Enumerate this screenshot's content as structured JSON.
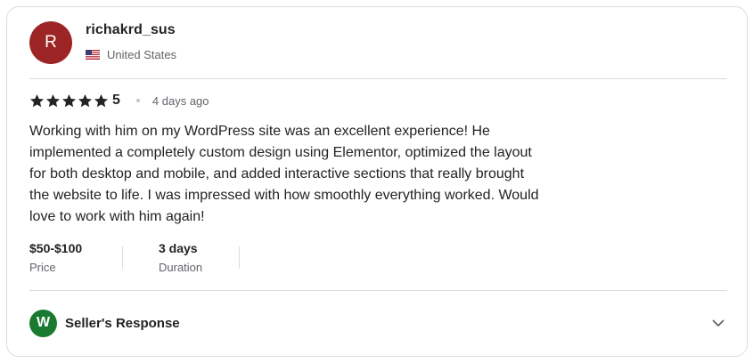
{
  "reviewer": {
    "avatar_initial": "R",
    "avatar_color": "#9c2424",
    "username": "richakrd_sus",
    "country": "United States",
    "flag_icon": "us-flag-icon"
  },
  "rating": {
    "stars": 5,
    "max_stars": 5,
    "value_text": "5",
    "time_ago": "4 days ago"
  },
  "review": {
    "text": "Working with him on my WordPress site was an excellent experience! He implemented a completely custom design using Elementor, optimized the layout for both desktop and mobile, and added interactive sections that really brought the website to life. I was impressed with how smoothly everything worked. Would love to work with him again!"
  },
  "meta": {
    "price_value": "$50-$100",
    "price_label": "Price",
    "duration_value": "3 days",
    "duration_label": "Duration"
  },
  "seller_response": {
    "avatar_initial": "W",
    "avatar_color": "#1a7a2f",
    "label": "Seller's Response",
    "expand_icon": "chevron-down-icon"
  }
}
